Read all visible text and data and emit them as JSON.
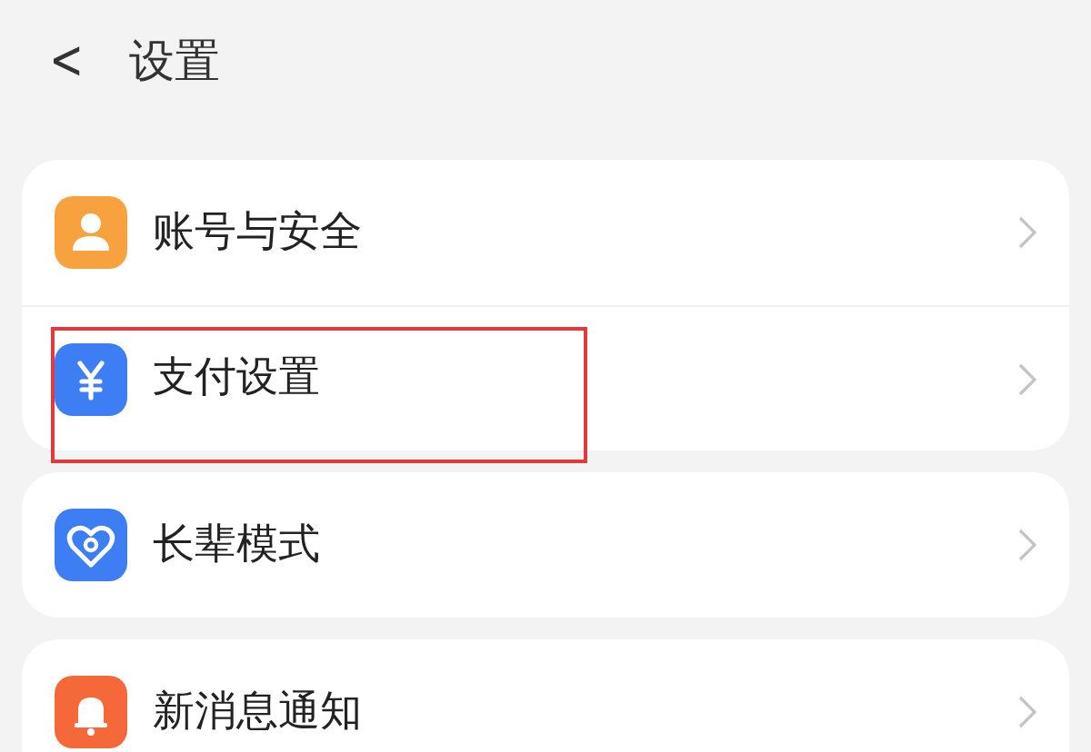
{
  "header": {
    "back": "<",
    "title": "设置"
  },
  "groups": [
    {
      "items": [
        {
          "kind": "account",
          "label": "账号与安全",
          "color": "#f8a13f",
          "highlighted": false
        },
        {
          "kind": "payment",
          "label": "支付设置",
          "color": "#3d7ef5",
          "highlighted": true
        }
      ]
    },
    {
      "items": [
        {
          "kind": "elder",
          "label": "长辈模式",
          "color": "#3d7ef5",
          "highlighted": false
        }
      ]
    },
    {
      "items": [
        {
          "kind": "notification",
          "label": "新消息通知",
          "color": "#f4683a",
          "highlighted": false
        }
      ]
    }
  ]
}
